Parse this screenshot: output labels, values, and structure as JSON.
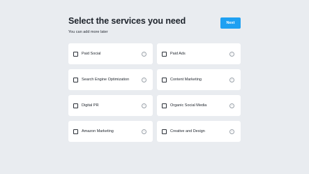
{
  "header": {
    "title": "Select the services you need",
    "subtitle": "You can add more later",
    "next_label": "Next"
  },
  "services": [
    {
      "label": "Paid Social",
      "checked": false
    },
    {
      "label": "Paid Ads",
      "checked": false
    },
    {
      "label": "Search Engine Optimization",
      "checked": false
    },
    {
      "label": "Content Marketing",
      "checked": false
    },
    {
      "label": "Digital PR",
      "checked": false
    },
    {
      "label": "Organic Social Media",
      "checked": false
    },
    {
      "label": "Amazon Marketing",
      "checked": false
    },
    {
      "label": "Creative and Design",
      "checked": false
    }
  ],
  "colors": {
    "background": "#e9ecf0",
    "accent": "#1ea0f2",
    "card": "#ffffff",
    "text": "#1d232b",
    "info_icon": "#9aa1a9"
  },
  "icons": {
    "info": "info-icon",
    "info_glyph": "i"
  }
}
